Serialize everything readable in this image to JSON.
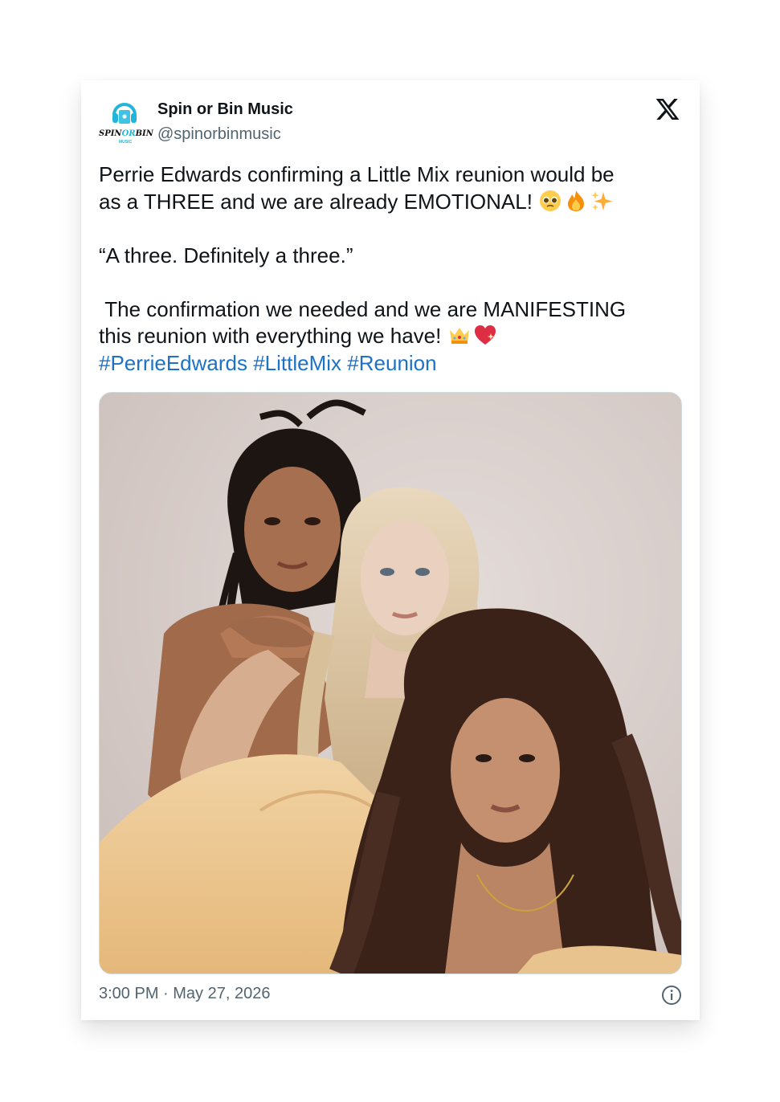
{
  "account": {
    "display_name": "Spin or Bin Music",
    "handle": "@spinorbinmusic",
    "avatar_logo_text_a": "SPIN",
    "avatar_logo_text_or": "OR",
    "avatar_logo_text_b": "BIN",
    "avatar_logo_sub": "MUSIC",
    "avatar_icon": "headphones-icon"
  },
  "platform_icon": "x-logo-icon",
  "tweet": {
    "line1": "Perrie Edwards confirming a Little Mix reunion would be",
    "line2": "as a THREE and we are already EMOTIONAL! ",
    "line2_emojis": [
      "pleading-face-emoji",
      "fire-emoji",
      "sparkles-emoji"
    ],
    "quote": "“A three. Definitely a three.”",
    "line4": " The confirmation we needed and we are MANIFESTING",
    "line5": "this reunion with everything we have! ",
    "line5_emojis": [
      "crown-emoji",
      "sparkling-heart-emoji"
    ],
    "hashtags": [
      "#PerrieEdwards",
      "#LittleMix",
      "#Reunion"
    ]
  },
  "media": {
    "description_icon": "photo-three-women"
  },
  "footer": {
    "timestamp": "3:00 PM · May 27, 2026",
    "info_icon": "info-icon"
  },
  "colors": {
    "text": "#0f1419",
    "secondary": "#536471",
    "link": "#1d72c8",
    "logo_accent": "#22b5d9"
  }
}
